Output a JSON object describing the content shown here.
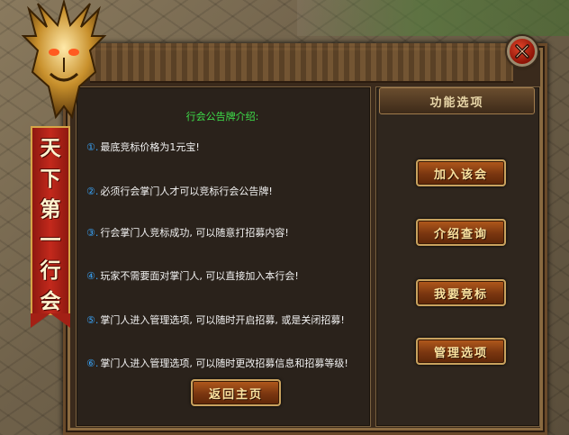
{
  "banner": {
    "chars": [
      "天",
      "下",
      "第",
      "一",
      "行",
      "会"
    ]
  },
  "panel": {
    "options_header": "功能选项",
    "notice_title": "行会公告牌介绍:",
    "rules": [
      {
        "num": "①.",
        "text": "最底竞标价格为1元宝!"
      },
      {
        "num": "②.",
        "text": "必须行会掌门人才可以竞标行会公告牌!"
      },
      {
        "num": "③.",
        "text": "行会掌门人竞标成功, 可以随意打招募内容!"
      },
      {
        "num": "④.",
        "text": "玩家不需要面对掌门人, 可以直接加入本行会!"
      },
      {
        "num": "⑤.",
        "text": "掌门人进入管理选项, 可以随时开启招募, 或是关闭招募!"
      },
      {
        "num": "⑥.",
        "text": "掌门人进入管理选项, 可以随时更改招募信息和招募等级!"
      }
    ],
    "back_button": "返回主页"
  },
  "options": {
    "join": "加入该会",
    "intro": "介绍查询",
    "bid": "我要竞标",
    "manage": "管理选项"
  },
  "icons": {
    "close": "close-icon",
    "dragon": "dragon-emblem-icon"
  },
  "colors": {
    "notice_title": "#3ee04a",
    "rule_number": "#3aa8ff",
    "rule_text": "#f2f2f2",
    "button_text": "#fbe3a0",
    "banner_red": "#c3291c"
  }
}
